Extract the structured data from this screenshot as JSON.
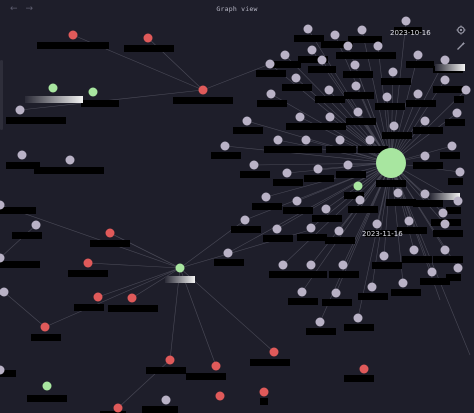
{
  "window": {
    "title": "Graph view"
  },
  "nav": {
    "back_glyph": "←",
    "forward_glyph": "→"
  },
  "controls": [
    {
      "name": "settings-icon",
      "icon": "gear"
    },
    {
      "name": "animate-icon",
      "icon": "magic-wand"
    }
  ],
  "graph": {
    "date_labels": [
      "2023-10-16",
      "2023-11-16"
    ],
    "colors": {
      "background": "#1e1e2a",
      "edge": "#4b4b58",
      "node_default": "#b9b2c6",
      "node_tag": "#e05a5a",
      "node_attachment": "#a8e6a0",
      "label_redacted": "#000000"
    }
  }
}
